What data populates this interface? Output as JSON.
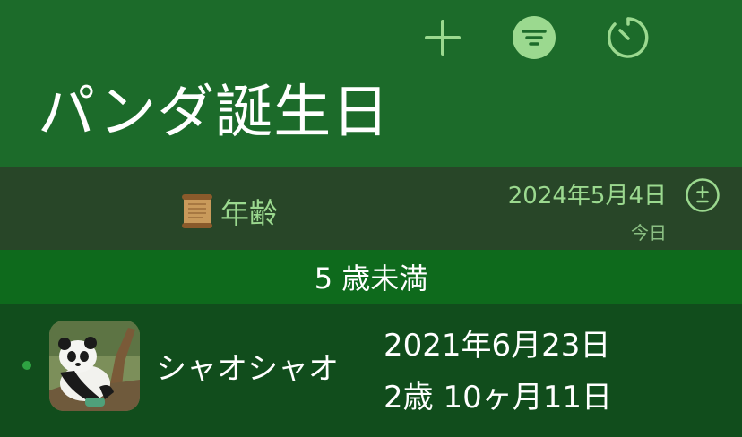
{
  "header": {
    "title": "パンダ誕生日",
    "add_icon": "plus-icon",
    "filter_icon": "filter-icon",
    "timer_icon": "timer-icon"
  },
  "subheader": {
    "label": "年齢",
    "label_icon": "scroll-icon",
    "date": "2024年5月4日",
    "date_caption": "今日",
    "adjust_icon": "plus-minus-icon"
  },
  "section": {
    "title": "5 歳未満"
  },
  "rows": [
    {
      "name": "シャオシャオ",
      "birthday": "2021年6月23日",
      "age": "2歳 10ヶ月11日"
    }
  ],
  "colors": {
    "header_bg": "#1c6b2a",
    "subheader_bg": "#284628",
    "section_bg": "#0e6a1c",
    "row_bg": "#114d1c",
    "accent": "#9bd98f",
    "status_dot": "#2ea342"
  }
}
